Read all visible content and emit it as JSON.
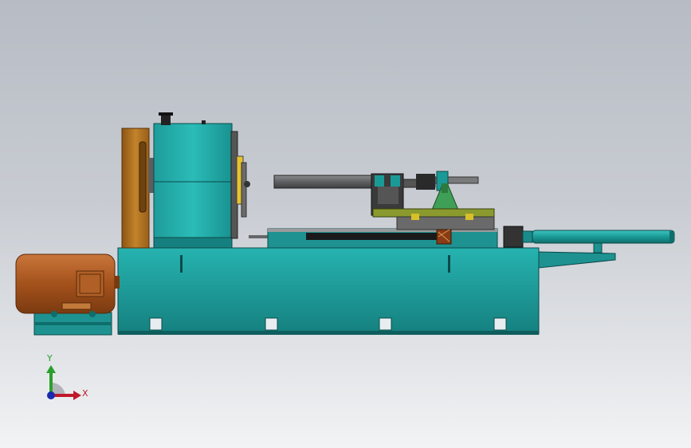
{
  "viewport": {
    "background_top": "#b7bcc4",
    "background_bottom": "#f2f3f4"
  },
  "colors": {
    "teal": "#1a8a8a",
    "teal_light": "#25b0ad",
    "bronze": "#a86a1e",
    "motor_brown": "#b05a22",
    "olive": "#8a9a2e",
    "green_bracket": "#4d9a4d",
    "gray_tube": "#6e7072",
    "axis_x": "#c0182a",
    "axis_y": "#2aa02a",
    "axis_z": "#1a2ab0"
  },
  "triad": {
    "x_label": "X",
    "y_label": "Y",
    "icon": "coordinate-triad-icon"
  }
}
